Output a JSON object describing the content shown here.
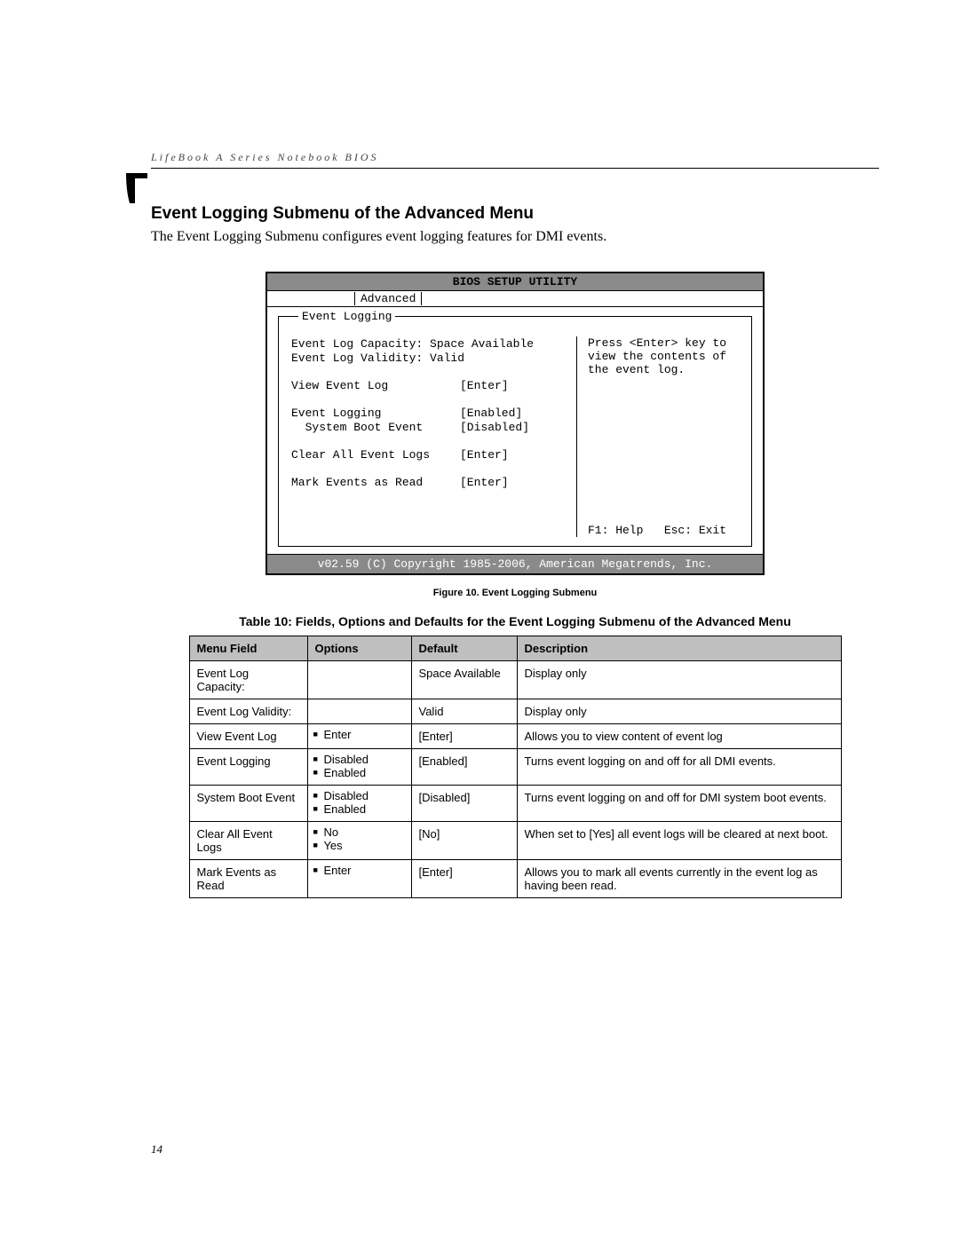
{
  "running_head": "LifeBook A Series Notebook BIOS",
  "section_title": "Event Logging Submenu of the Advanced Menu",
  "intro": "The Event Logging Submenu configures event logging features for DMI events.",
  "bios": {
    "title": "BIOS SETUP UTILITY",
    "active_tab": "Advanced",
    "panel_title": "Event Logging",
    "rows": [
      {
        "label": "Event Log Capacity: Space Available",
        "value": ""
      },
      {
        "label": "Event Log Validity: Valid",
        "value": ""
      },
      {
        "gap": true
      },
      {
        "label": "View Event Log",
        "value": "[Enter]"
      },
      {
        "gap": true
      },
      {
        "label": "Event Logging",
        "value": "[Enabled]"
      },
      {
        "label": "  System Boot Event",
        "value": "[Disabled]"
      },
      {
        "gap": true
      },
      {
        "label": "Clear All Event Logs",
        "value": "[Enter]"
      },
      {
        "gap": true
      },
      {
        "label": "Mark Events as Read",
        "value": "[Enter]"
      }
    ],
    "help_text": "Press <Enter> key to view the contents of the event log.",
    "keys": "F1: Help   Esc: Exit",
    "copyright": "v02.59 (C) Copyright 1985-2006, American Megatrends, Inc."
  },
  "figure_caption": "Figure 10.  Event Logging Submenu",
  "table_title": "Table 10: Fields, Options and Defaults for the Event Logging Submenu of the Advanced Menu",
  "table": {
    "headers": {
      "field": "Menu Field",
      "options": "Options",
      "def": "Default",
      "desc": "Description"
    },
    "rows": [
      {
        "field": "Event Log Capacity:",
        "options": [],
        "def": "Space Available",
        "desc": "Display only"
      },
      {
        "field": "Event Log Validity:",
        "options": [],
        "def": "Valid",
        "desc": "Display only"
      },
      {
        "field": "View Event Log",
        "options": [
          "Enter"
        ],
        "def": "[Enter]",
        "desc": "Allows you to view content of event log"
      },
      {
        "field": "Event Logging",
        "options": [
          "Disabled",
          "Enabled"
        ],
        "def": "[Enabled]",
        "desc": "Turns event logging on and off for all DMI events."
      },
      {
        "field": "System Boot Event",
        "options": [
          "Disabled",
          "Enabled"
        ],
        "def": "[Disabled]",
        "desc": "Turns event logging on and off for DMI system boot events."
      },
      {
        "field": "Clear All Event Logs",
        "options": [
          "No",
          "Yes"
        ],
        "def": "[No]",
        "desc": "When set to [Yes] all event logs will be cleared at next boot."
      },
      {
        "field": "Mark Events as Read",
        "options": [
          "Enter"
        ],
        "def": "[Enter]",
        "desc": "Allows you to mark all events currently in the event log as having been read."
      }
    ]
  },
  "page_number": "14"
}
